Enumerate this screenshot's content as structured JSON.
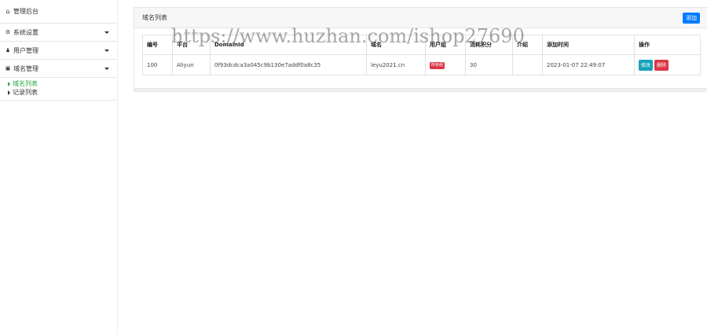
{
  "sidebar": {
    "brand": {
      "label": "管理后台",
      "icon": "home-icon"
    },
    "items": [
      {
        "label": "系统设置",
        "icon": "gear-icon"
      },
      {
        "label": "用户管理",
        "icon": "user-icon"
      },
      {
        "label": "域名管理",
        "icon": "cube-icon"
      }
    ],
    "sub_items": [
      {
        "label": "域名列表",
        "active": true
      },
      {
        "label": "记录列表",
        "active": false
      }
    ]
  },
  "main": {
    "title": "域名列表",
    "add_label": "添加",
    "table": {
      "headers": [
        "编号",
        "平台",
        "DomainId",
        "域名",
        "用户组",
        "消耗积分",
        "介绍",
        "添加时间",
        "操作"
      ],
      "rows": [
        {
          "id": "100",
          "platform": "Aliyun",
          "domain_id": "0f93dcdca3a045c9b130e7addf0a8c35",
          "domain": "leyu2021.cn",
          "group_badge": "所有组",
          "points": "30",
          "intro": "",
          "created": "2023-01-07 22:49:07",
          "edit_label": "修改",
          "delete_label": "删除"
        }
      ]
    }
  },
  "watermark": "https://www.huzhan.com/ishop27690",
  "colors": {
    "primary": "#007bff",
    "info": "#17a2b8",
    "danger": "#dc3545",
    "success": "#28a745"
  }
}
